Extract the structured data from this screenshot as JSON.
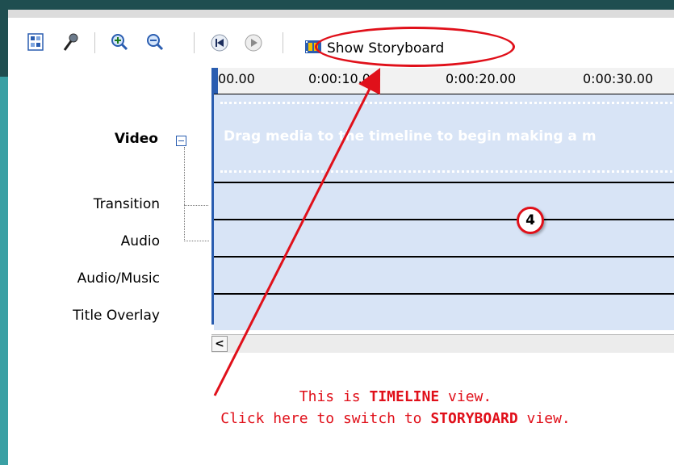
{
  "toolbar": {
    "show_storyboard_label": "Show Storyboard",
    "icons": [
      "storyboard-set-icon",
      "microphone-icon",
      "zoom-in-icon",
      "zoom-out-icon",
      "rewind-icon",
      "play-icon",
      "filmstrip-icon"
    ]
  },
  "ruler": {
    "ticks": [
      "00.00",
      "0:00:10.00",
      "0:00:20.00",
      "0:00:30.00"
    ]
  },
  "tracks": {
    "video": "Video",
    "transition": "Transition",
    "audio": "Audio",
    "audio_music": "Audio/Music",
    "title_overlay": "Title Overlay"
  },
  "video_hint": "Drag media to the timeline to begin making a m",
  "annotation": {
    "step_number": "4",
    "line1_prefix": "This is ",
    "line1_bold": "TIMELINE",
    "line1_suffix": " view.",
    "line2_prefix": "Click here to switch to ",
    "line2_bold": "STORYBOARD",
    "line2_suffix": " view.",
    "color": "#e0101a"
  },
  "colors": {
    "frame": "#1f4e50",
    "frame_accent": "#3aa0a4",
    "track_bg": "#d8e4f6",
    "playhead": "#2a5db0"
  }
}
